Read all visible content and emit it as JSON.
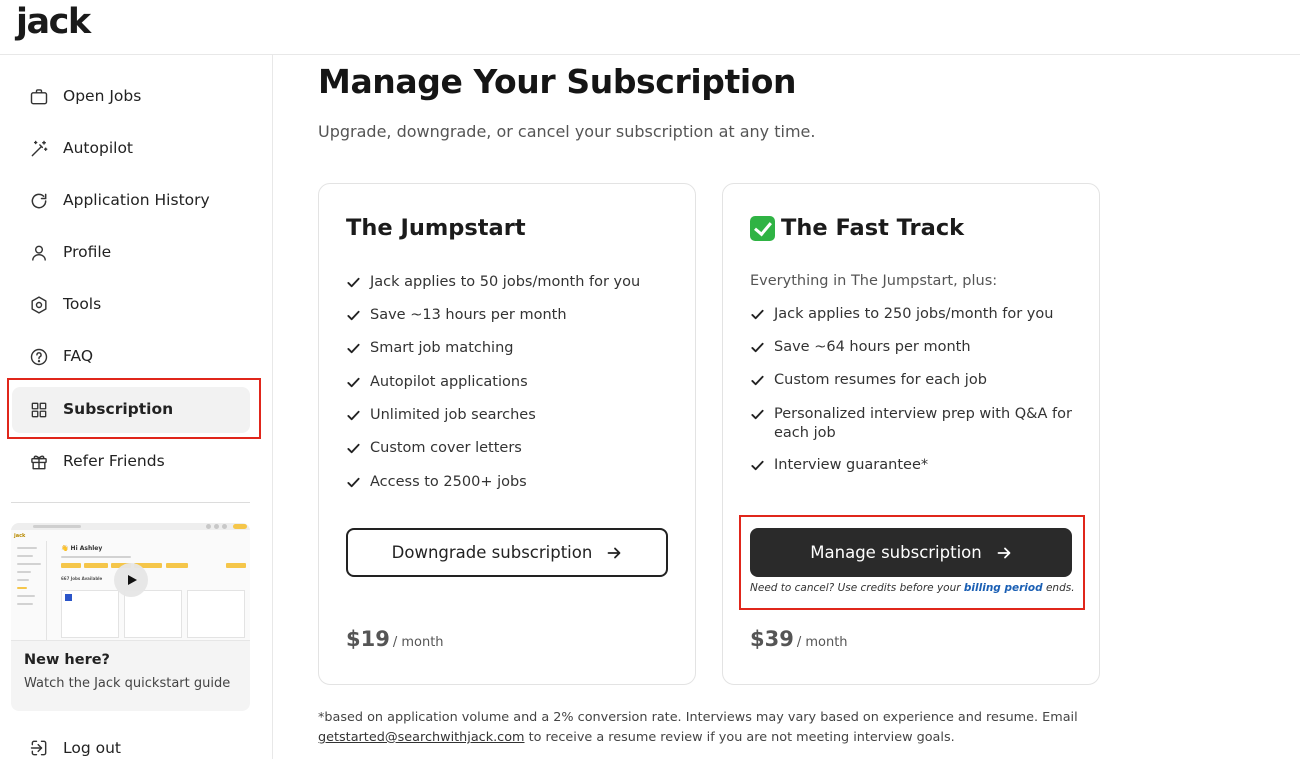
{
  "app": {
    "logo": "jack"
  },
  "sidebar": {
    "items": [
      {
        "label": "Open Jobs",
        "icon": "briefcase-icon"
      },
      {
        "label": "Autopilot",
        "icon": "magic-wand-icon"
      },
      {
        "label": "Application History",
        "icon": "refresh-icon"
      },
      {
        "label": "Profile",
        "icon": "user-icon"
      },
      {
        "label": "Tools",
        "icon": "hexagon-settings-icon"
      },
      {
        "label": "FAQ",
        "icon": "help-circle-icon"
      },
      {
        "label": "Subscription",
        "icon": "grid-icon",
        "active": true
      },
      {
        "label": "Refer Friends",
        "icon": "gift-icon"
      }
    ],
    "guide": {
      "title": "New here?",
      "subtitle": "Watch the Jack quickstart guide",
      "thumb_title": "👋 Hi Ashley",
      "thumb_jobs": "667 Jobs Available"
    },
    "logout": {
      "label": "Log out",
      "icon": "logout-icon"
    }
  },
  "main": {
    "title": "Manage Your Subscription",
    "subtitle": "Upgrade, downgrade, or cancel your subscription at any time.",
    "plans": [
      {
        "name": "The Jumpstart",
        "features": [
          "Jack applies to 50 jobs/month for you",
          "Save ~13 hours per month",
          "Smart job matching",
          "Autopilot applications",
          "Unlimited job searches",
          "Custom cover letters",
          "Access to 2500+ jobs"
        ],
        "button": "Downgrade subscription",
        "price": "$19",
        "period": "/ month"
      },
      {
        "name": "The Fast Track",
        "current": true,
        "intro": "Everything in The Jumpstart, plus:",
        "features": [
          "Jack applies to 250 jobs/month for you",
          "Save ~64 hours per month",
          "Custom resumes for each job",
          "Personalized interview prep with Q&A for each job",
          "Interview guarantee*"
        ],
        "button": "Manage subscription",
        "cancel_note_pre": "Need to cancel? Use credits before your ",
        "cancel_note_link": "billing period",
        "cancel_note_post": " ends.",
        "price": "$39",
        "period": "/ month"
      }
    ],
    "footnote_pre": "*based on application volume and a 2% conversion rate. Interviews may vary based on experience and resume. Email ",
    "footnote_email": "getstarted@searchwithjack.com",
    "footnote_post": " to receive a resume review if you are not meeting interview goals."
  },
  "colors": {
    "highlight": "#e0261b",
    "dark_button": "#2a2a2a",
    "link": "#1a5fb4",
    "check_emoji": "#2fb344"
  }
}
